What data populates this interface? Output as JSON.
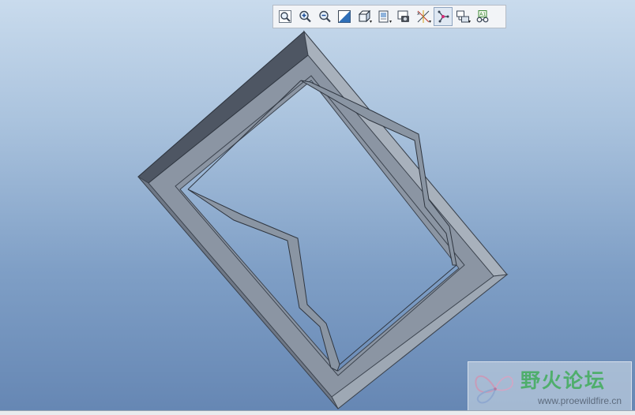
{
  "toolbar": {
    "buttons": [
      {
        "name": "refit-button",
        "icon": "refit-icon"
      },
      {
        "name": "zoom-in-button",
        "icon": "zoom-in-icon"
      },
      {
        "name": "zoom-out-button",
        "icon": "zoom-out-icon"
      },
      {
        "name": "repaint-button",
        "icon": "repaint-icon"
      },
      {
        "name": "display-style-button",
        "icon": "display-style-icon"
      },
      {
        "name": "saved-views-button",
        "icon": "saved-views-icon"
      },
      {
        "name": "view-manager-button",
        "icon": "view-manager-icon"
      },
      {
        "name": "datum-display-button",
        "icon": "datum-display-icon"
      },
      {
        "name": "spin-center-button",
        "icon": "spin-center-icon",
        "active": true
      },
      {
        "name": "orient-mode-button",
        "icon": "orient-mode-icon"
      },
      {
        "name": "annotation-display-button",
        "icon": "annotation-display-icon"
      }
    ]
  },
  "watermark": {
    "title": "野火论坛",
    "url": "www.proewildfire.cn"
  },
  "colors": {
    "background_top": "#c9dbed",
    "background_bottom": "#6586b3",
    "model_face": "#8893a1",
    "model_dark": "#4e5663",
    "model_light": "#aab3be"
  }
}
